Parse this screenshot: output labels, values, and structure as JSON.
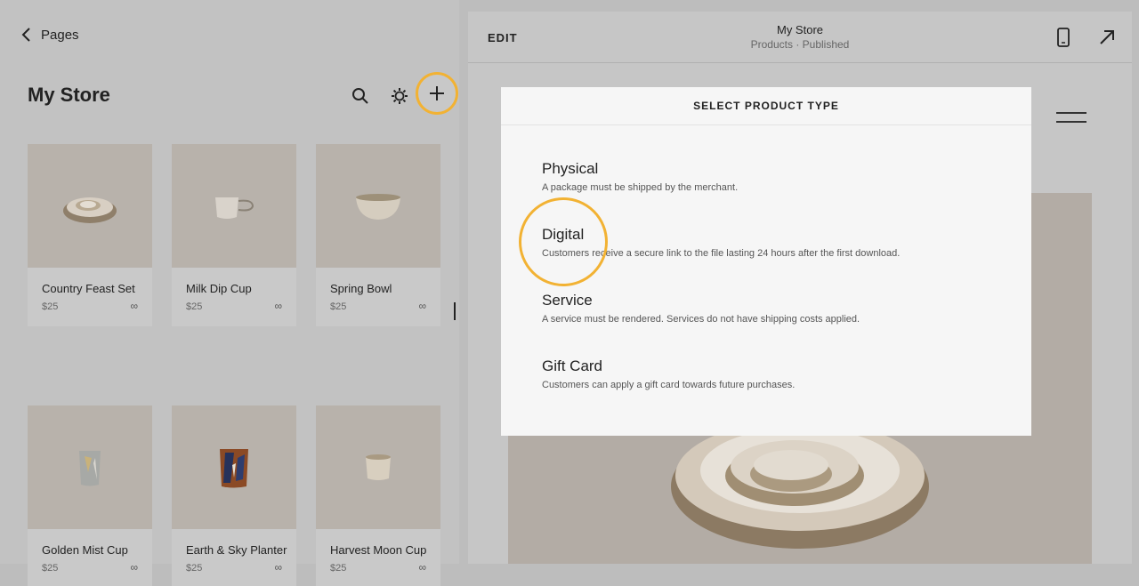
{
  "left": {
    "back_label": "Pages",
    "title": "My Store",
    "icons": [
      "search-icon",
      "gear-icon",
      "plus-icon"
    ],
    "products": [
      {
        "name": "Country Feast Set",
        "price": "$25",
        "stock": "∞"
      },
      {
        "name": "Milk Dip Cup",
        "price": "$25",
        "stock": "∞"
      },
      {
        "name": "Spring Bowl",
        "price": "$25",
        "stock": "∞"
      },
      {
        "name": "Golden Mist Cup",
        "price": "$25",
        "stock": "∞"
      },
      {
        "name": "Earth & Sky Planter",
        "price": "$25",
        "stock": "∞"
      },
      {
        "name": "Harvest Moon Cup",
        "price": "$25",
        "stock": "∞"
      }
    ]
  },
  "right": {
    "edit_label": "EDIT",
    "site_name": "My Store",
    "site_status": "Products · Published"
  },
  "modal": {
    "title": "SELECT PRODUCT TYPE",
    "options": [
      {
        "title": "Physical",
        "desc": "A package must be shipped by the merchant."
      },
      {
        "title": "Digital",
        "desc": "Customers receive a secure link to the file lasting 24 hours after the first download."
      },
      {
        "title": "Service",
        "desc": "A service must be rendered. Services do not have shipping costs applied."
      },
      {
        "title": "Gift Card",
        "desc": "Customers can apply a gift card towards future purchases."
      }
    ]
  },
  "colors": {
    "highlight_ring": "#f2b233",
    "overlay_gray": "#c2c2c2",
    "modal_bg": "#f6f6f6"
  }
}
